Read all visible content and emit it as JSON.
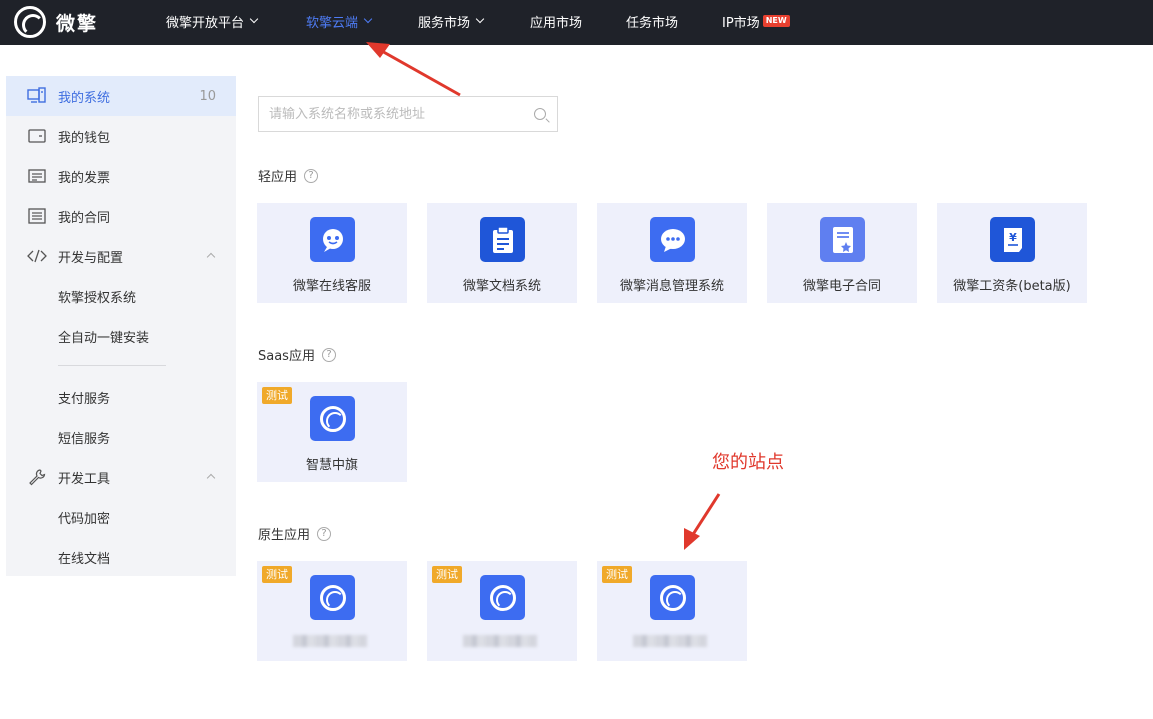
{
  "brand": {
    "name": "微擎"
  },
  "nav": [
    {
      "label": "微擎开放平台",
      "dropdown": true,
      "active": false
    },
    {
      "label": "软擎云端",
      "dropdown": true,
      "active": true
    },
    {
      "label": "服务市场",
      "dropdown": true,
      "active": false
    },
    {
      "label": "应用市场",
      "dropdown": false,
      "active": false
    },
    {
      "label": "任务市场",
      "dropdown": false,
      "active": false
    },
    {
      "label": "IP市场",
      "dropdown": false,
      "active": false,
      "badge": "NEW"
    }
  ],
  "sidebar": {
    "items": [
      {
        "label": "我的系统",
        "count": "10",
        "icon": "systems-icon",
        "active": true
      },
      {
        "label": "我的钱包",
        "icon": "wallet-icon"
      },
      {
        "label": "我的发票",
        "icon": "invoice-icon"
      },
      {
        "label": "我的合同",
        "icon": "contract-icon"
      },
      {
        "label": "开发与配置",
        "icon": "code-icon",
        "expanded": true
      },
      {
        "label": "软擎授权系统"
      },
      {
        "label": "全自动一键安装"
      },
      {
        "label": "支付服务"
      },
      {
        "label": "短信服务"
      },
      {
        "label": "开发工具",
        "icon": "wrench-icon",
        "expanded": true
      },
      {
        "label": "代码加密"
      },
      {
        "label": "在线文档"
      }
    ]
  },
  "search": {
    "placeholder": "请输入系统名称或系统地址"
  },
  "sections": {
    "light": {
      "title": "轻应用",
      "apps": [
        {
          "label": "微擎在线客服",
          "icon": "chat-bot-icon"
        },
        {
          "label": "微擎文档系统",
          "icon": "clipboard-icon"
        },
        {
          "label": "微擎消息管理系统",
          "icon": "message-icon"
        },
        {
          "label": "微擎电子合同",
          "icon": "certificate-icon"
        },
        {
          "label": "微擎工资条(beta版)",
          "icon": "payslip-icon"
        }
      ]
    },
    "saas": {
      "title": "Saas应用",
      "apps": [
        {
          "label": "智慧中旗",
          "tag": "测试"
        }
      ]
    },
    "native": {
      "title": "原生应用",
      "apps": [
        {
          "tag": "测试"
        },
        {
          "tag": "测试"
        },
        {
          "tag": "测试"
        }
      ]
    }
  },
  "annotation": {
    "text": "您的站点",
    "color": "#e0382c"
  },
  "colors": {
    "accent": "#3d6cf1",
    "topbar": "#1f2229",
    "tag": "#f0a92a",
    "card_bg": "#eef0fb"
  }
}
